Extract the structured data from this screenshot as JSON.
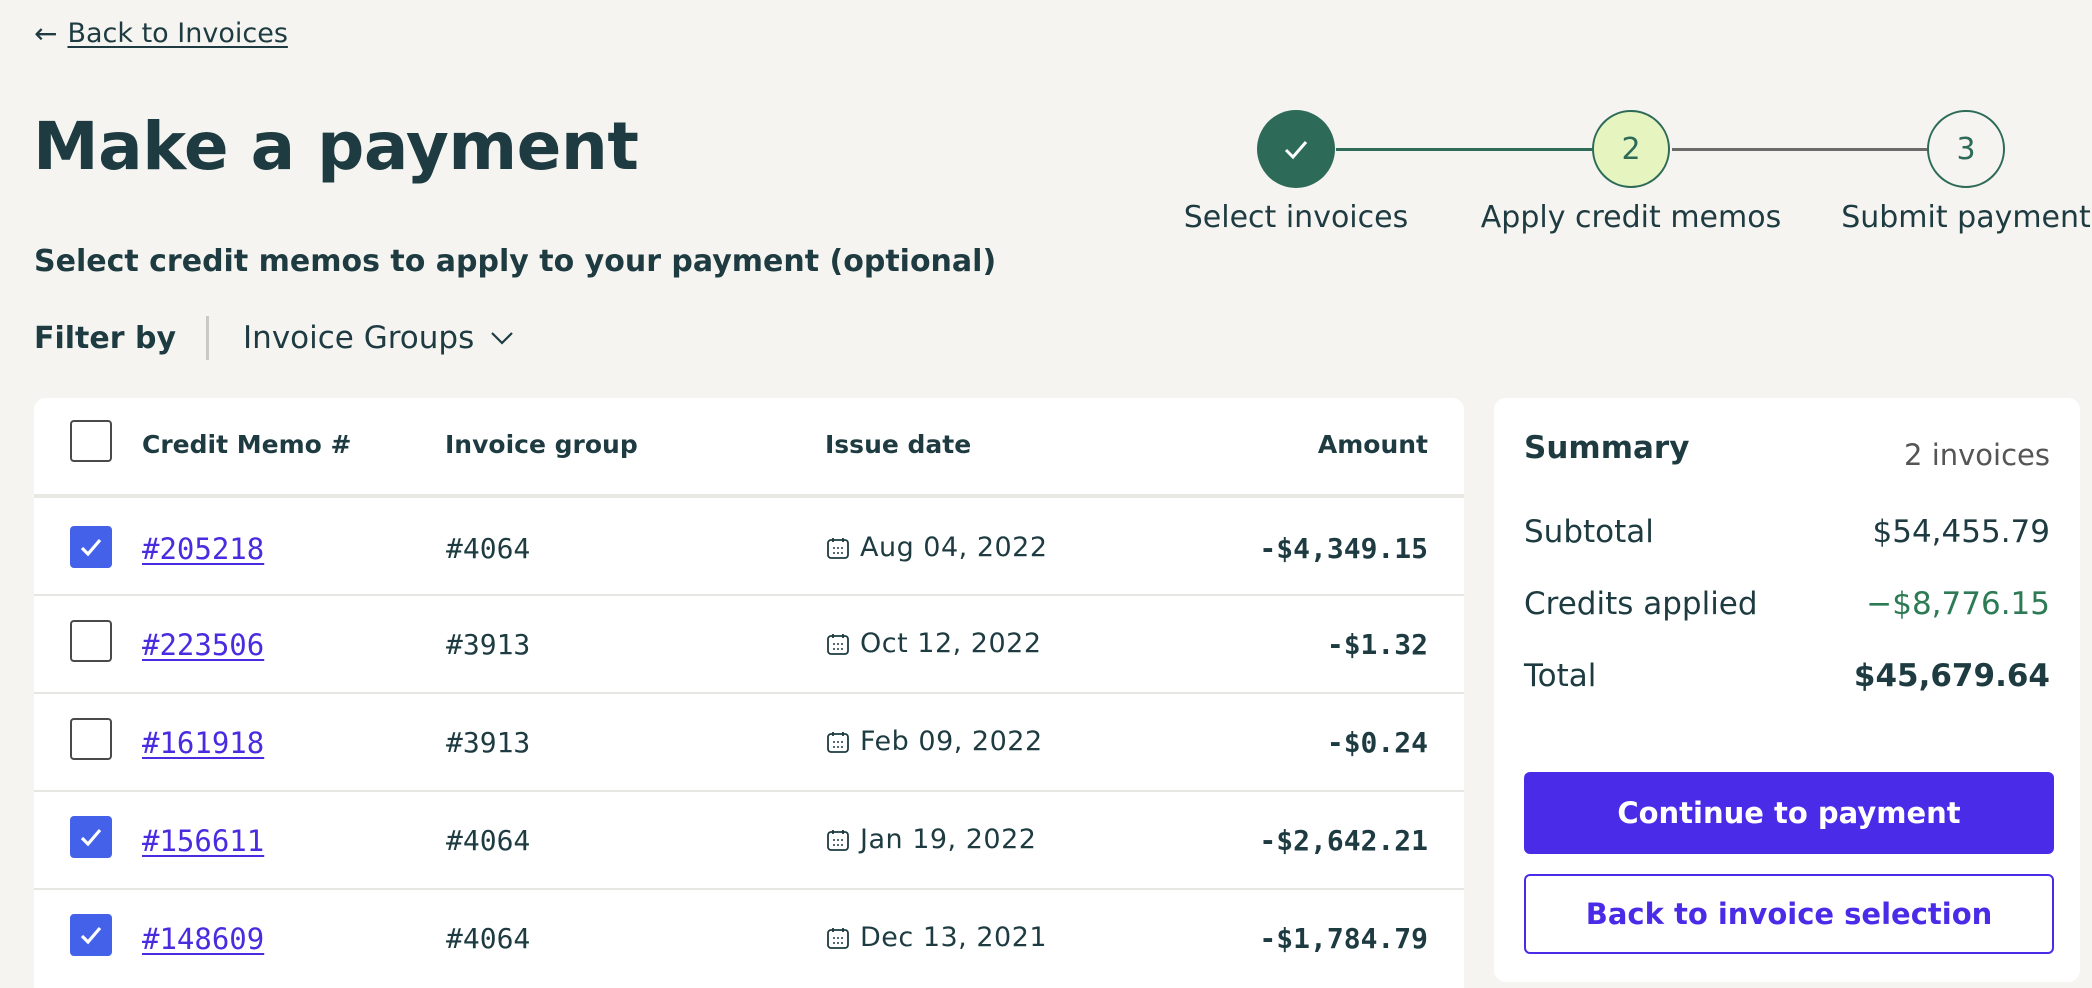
{
  "nav": {
    "back_label": "Back to Invoices"
  },
  "page": {
    "title": "Make a payment",
    "subheading": "Select credit memos to apply to your payment (optional)"
  },
  "filter": {
    "label": "Filter by",
    "select_value": "Invoice Groups"
  },
  "stepper": {
    "steps": [
      {
        "label": "Select invoices",
        "state": "complete",
        "number": ""
      },
      {
        "label": "Apply credit memos",
        "state": "current",
        "number": "2"
      },
      {
        "label": "Submit payment",
        "state": "upcoming",
        "number": "3"
      }
    ]
  },
  "table": {
    "columns": {
      "memo": "Credit Memo #",
      "group": "Invoice group",
      "date": "Issue date",
      "amount": "Amount"
    },
    "rows": [
      {
        "checked": true,
        "memo": "#205218",
        "group": "#4064",
        "date": "Aug 04, 2022",
        "amount": "-$4,349.15"
      },
      {
        "checked": false,
        "memo": "#223506",
        "group": "#3913",
        "date": "Oct 12, 2022",
        "amount": "-$1.32"
      },
      {
        "checked": false,
        "memo": "#161918",
        "group": "#3913",
        "date": "Feb 09, 2022",
        "amount": "-$0.24"
      },
      {
        "checked": true,
        "memo": "#156611",
        "group": "#4064",
        "date": "Jan 19, 2022",
        "amount": "-$2,642.21"
      },
      {
        "checked": true,
        "memo": "#148609",
        "group": "#4064",
        "date": "Dec 13, 2021",
        "amount": "-$1,784.79"
      }
    ]
  },
  "summary": {
    "title": "Summary",
    "count": "2 invoices",
    "subtotal_label": "Subtotal",
    "subtotal_value": "$54,455.79",
    "credits_label": "Credits applied",
    "credits_value": "−$8,776.15",
    "total_label": "Total",
    "total_value": "$45,679.64",
    "primary_button": "Continue to payment",
    "secondary_button": "Back to invoice selection"
  },
  "colors": {
    "text": "#1d3b40",
    "accent": "#4a2ce8",
    "complete_step": "#2d6b58",
    "current_step_fill": "#e6f5c0",
    "credit_green": "#2d7a55",
    "checkbox_checked": "#4461ea"
  }
}
